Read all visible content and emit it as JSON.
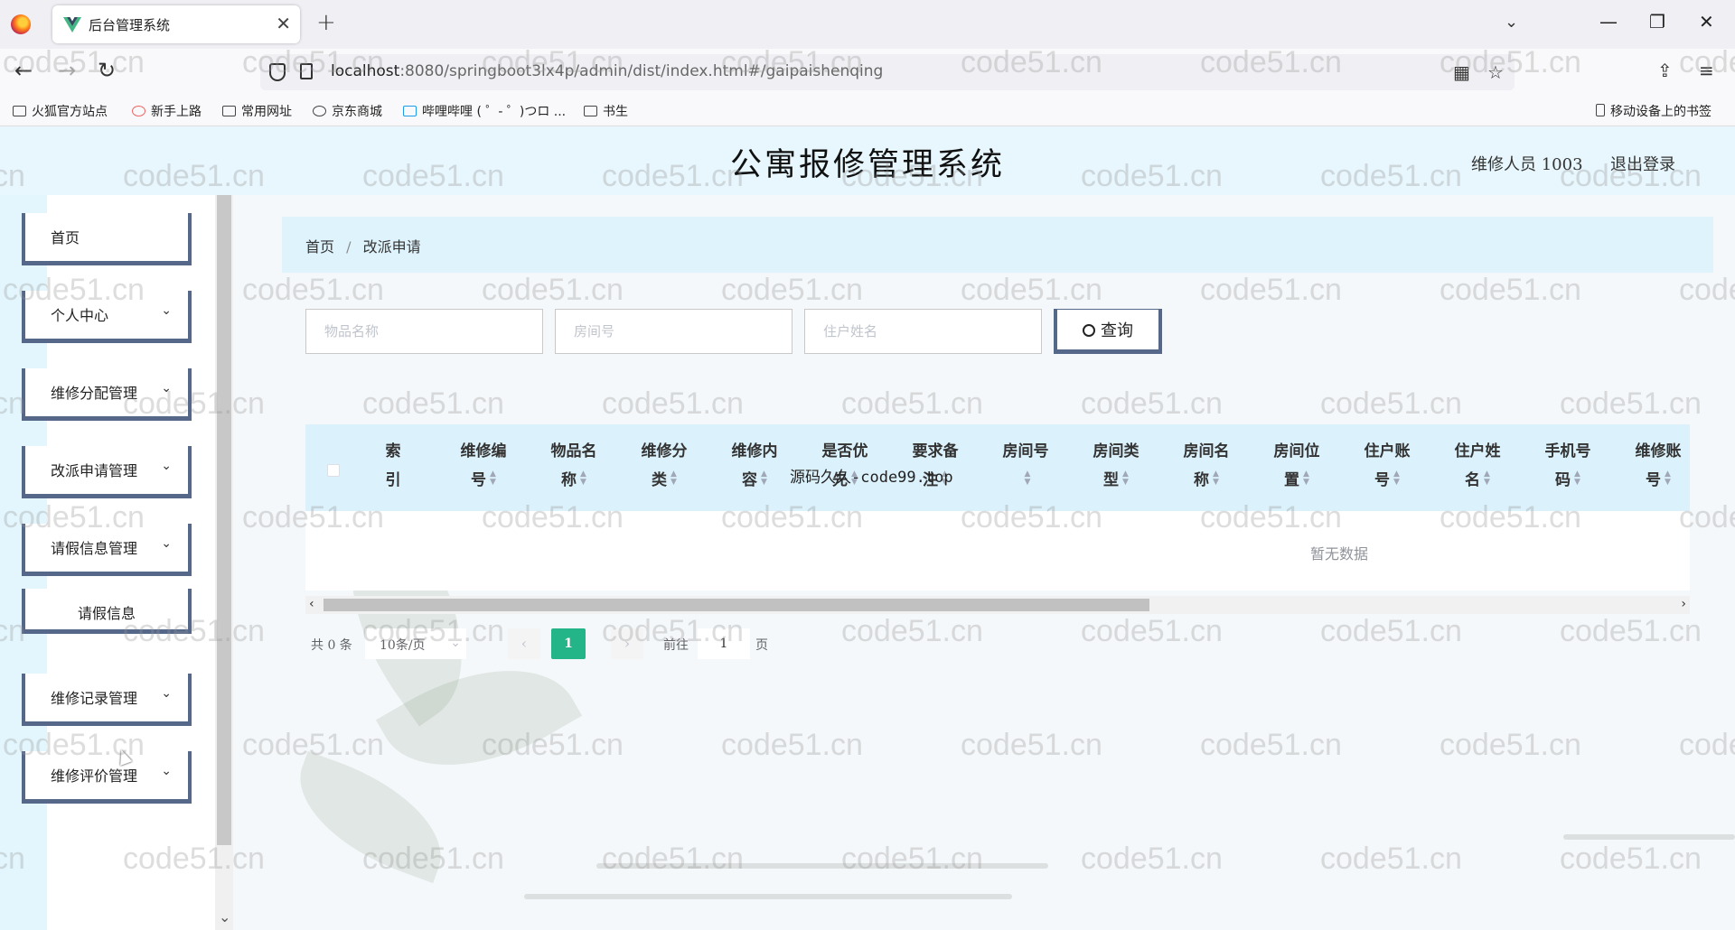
{
  "browser": {
    "tab_title": "后台管理系统",
    "url_host": "localhost",
    "url_rest": ":8080/springboot3lx4p/admin/dist/index.html#/gaipaishenqing",
    "bookmarks": [
      "火狐官方站点",
      "新手上路",
      "常用网址",
      "京东商城",
      "哔哩哔哩 ( ゜- ゜)つロ ...",
      "书生"
    ],
    "mobile_bookmarks": "移动设备上的书签"
  },
  "header": {
    "title": "公寓报修管理系统",
    "user_label": "维修人员 1003",
    "logout": "退出登录"
  },
  "sidebar": {
    "items": [
      {
        "label": "首页",
        "has_chevron": false
      },
      {
        "label": "个人中心",
        "has_chevron": true
      },
      {
        "label": "维修分配管理",
        "has_chevron": true
      },
      {
        "label": "改派申请管理",
        "has_chevron": true
      },
      {
        "label": "请假信息管理",
        "has_chevron": true
      },
      {
        "label": "请假信息",
        "has_chevron": false
      },
      {
        "label": "维修记录管理",
        "has_chevron": true
      },
      {
        "label": "维修评价管理",
        "has_chevron": true
      }
    ]
  },
  "breadcrumb": {
    "home": "首页",
    "separator": "/",
    "current": "改派申请"
  },
  "search": {
    "item_name_placeholder": "物品名称",
    "room_no_placeholder": "房间号",
    "resident_name_placeholder": "住户姓名",
    "query_label": "查询"
  },
  "table": {
    "columns": [
      {
        "l1": "索",
        "l2": "引",
        "sortable": false
      },
      {
        "l1": "维修编",
        "l2": "号",
        "sortable": true
      },
      {
        "l1": "物品名",
        "l2": "称",
        "sortable": true
      },
      {
        "l1": "维修分",
        "l2": "类",
        "sortable": true
      },
      {
        "l1": "维修内",
        "l2": "容",
        "sortable": true
      },
      {
        "l1": "是否优",
        "l2": "先",
        "sortable": true
      },
      {
        "l1": "要求备",
        "l2": "注",
        "sortable": true
      },
      {
        "l1": "房间号",
        "l2": "",
        "sortable": true
      },
      {
        "l1": "房间类",
        "l2": "型",
        "sortable": true
      },
      {
        "l1": "房间名",
        "l2": "称",
        "sortable": true
      },
      {
        "l1": "房间位",
        "l2": "置",
        "sortable": true
      },
      {
        "l1": "住户账",
        "l2": "号",
        "sortable": true
      },
      {
        "l1": "住户姓",
        "l2": "名",
        "sortable": true
      },
      {
        "l1": "手机号",
        "l2": "码",
        "sortable": true
      },
      {
        "l1": "维修账",
        "l2": "号",
        "sortable": true
      }
    ],
    "overlay_text": "源码久久-code99.top",
    "empty_text": "暂无数据"
  },
  "pagination": {
    "total": "共 0 条",
    "page_size": "10条/页",
    "current_page": "1",
    "goto_label": "前往",
    "goto_value": "1",
    "page_unit": "页"
  },
  "watermark": "code51.cn",
  "colors": {
    "header_bg": "#e7f7fd",
    "menu_border": "#56688a",
    "page_active": "#23b487",
    "table_header": "#dbf1fb"
  }
}
